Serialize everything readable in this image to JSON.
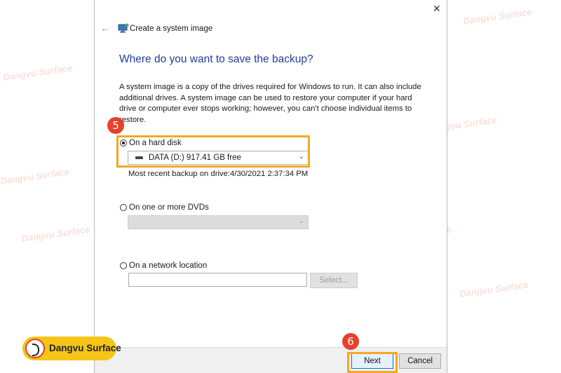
{
  "window": {
    "title": "Create a system image",
    "close_glyph": "✕",
    "back_glyph": "←"
  },
  "page": {
    "heading": "Where do you want to save the backup?",
    "description": "A system image is a copy of the drives required for Windows to run. It can also include additional drives. A system image can be used to restore your computer if your hard drive or computer ever stops working; however, you can't choose individual items to restore."
  },
  "options": {
    "hard_disk": {
      "label": "On a hard disk",
      "selected": true,
      "drive_value": "DATA (D:)  917.41 GB free",
      "recent_backup": "Most recent backup on drive:4/30/2021 2:37:34 PM"
    },
    "dvd": {
      "label": "On one or more DVDs",
      "selected": false,
      "drive_value": ""
    },
    "network": {
      "label": "On a network location",
      "selected": false,
      "path_value": "",
      "select_button": "Select..."
    }
  },
  "footer": {
    "next_label": "Next",
    "cancel_label": "Cancel"
  },
  "annotations": {
    "step5": "5",
    "step6": "6",
    "highlight_color": "#f7a624",
    "badge_color": "#e8402a"
  },
  "watermark": {
    "text": "Dangvu Surface",
    "logo_text": "Dangvu Surface"
  },
  "icons": {
    "chevron": "chevron-down-icon",
    "drive": "hard-drive-icon",
    "wizard": "system-image-icon"
  }
}
